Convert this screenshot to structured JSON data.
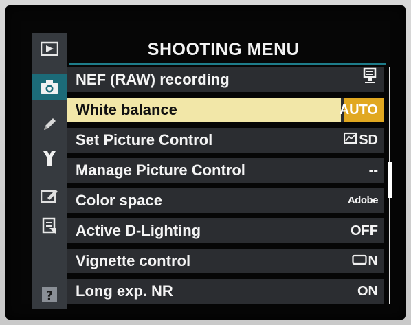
{
  "menu": {
    "title": "SHOOTING MENU",
    "items": [
      {
        "label": "NEF (RAW) recording",
        "value": "",
        "value_icon": "nef-raw-icon"
      },
      {
        "label": "White balance",
        "value": "AUTO",
        "selected": true
      },
      {
        "label": "Set Picture Control",
        "value": "SD",
        "value_icon": "picture-control-icon"
      },
      {
        "label": "Manage Picture Control",
        "value": "--"
      },
      {
        "label": "Color space",
        "value": "Adobe"
      },
      {
        "label": "Active D-Lighting",
        "value": "OFF"
      },
      {
        "label": "Vignette control",
        "value": "N",
        "value_icon": "vignette-frame-icon"
      },
      {
        "label": "Long exp. NR",
        "value": "ON"
      }
    ]
  },
  "tabs": [
    {
      "name": "playback-menu-tab",
      "icon": "playback-icon"
    },
    {
      "name": "shooting-menu-tab",
      "icon": "camera-icon",
      "active": true
    },
    {
      "name": "custom-settings-tab",
      "icon": "pencil-icon"
    },
    {
      "name": "setup-menu-tab",
      "icon": "wrench-icon"
    },
    {
      "name": "retouch-menu-tab",
      "icon": "retouch-icon"
    },
    {
      "name": "my-menu-tab",
      "icon": "my-menu-icon"
    },
    {
      "name": "help-tab",
      "icon": "help-icon"
    }
  ],
  "colors": {
    "accent": "#1c6b78",
    "selected_label_bg": "#f2e7a8",
    "selected_value_bg": "#e1a821",
    "row_bg": "#2b2d31"
  },
  "scroll": {
    "position_fraction": 0.45
  }
}
